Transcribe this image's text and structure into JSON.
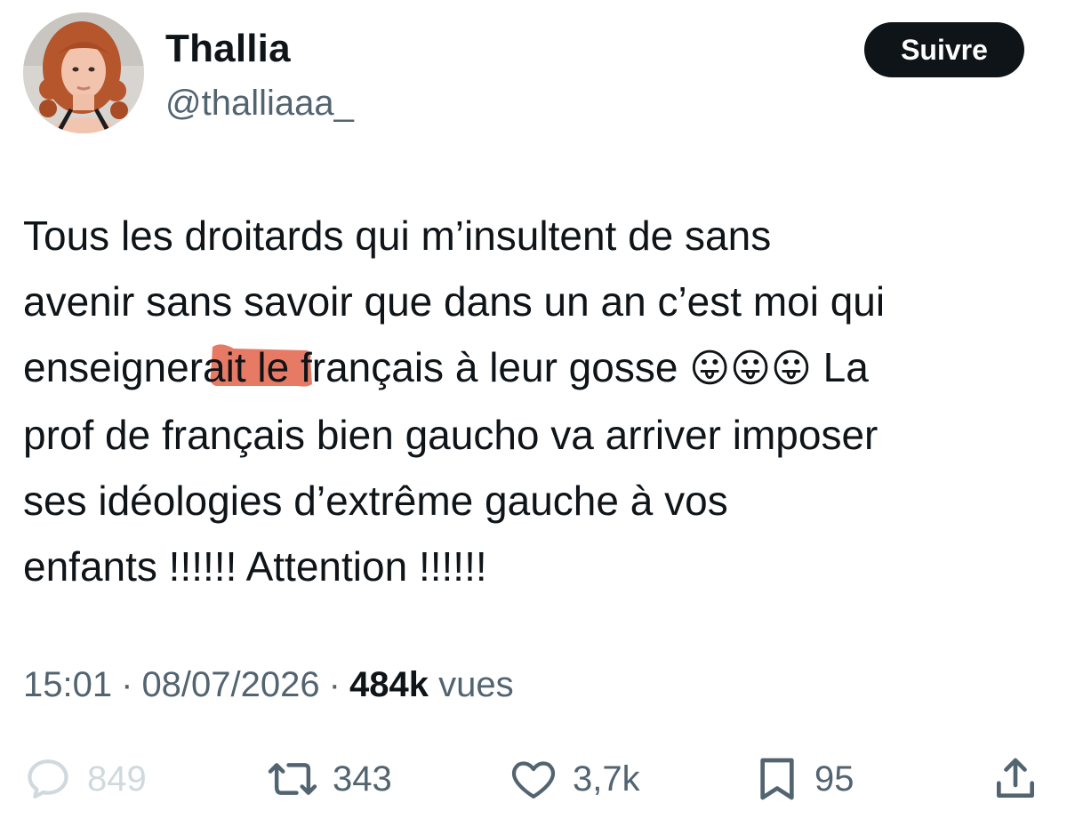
{
  "user": {
    "display_name": "Thallia",
    "handle": "@thalliaaa_",
    "follow_label": "Suivre"
  },
  "tweet": {
    "text_lines": [
      "Tous les droitards qui m’insultent de sans",
      "avenir sans savoir que dans un an c’est moi qui",
      "enseignerait le français à leur gosse ",
      "prof de français bien gaucho va arriver imposer",
      "ses idéologies d’extrême gauche à vos",
      "enfants !!!!!! Attention !!!!!!"
    ],
    "emojis": "😛😛😛",
    "line3_tail": " La",
    "highlight_color": "#e0553a"
  },
  "meta": {
    "time": "15:01",
    "date": "08/07/2026",
    "views_count": "484k",
    "views_label": "vues",
    "separator": "·"
  },
  "actions": {
    "reply": {
      "icon": "reply-icon",
      "count": "849"
    },
    "repost": {
      "icon": "repost-icon",
      "count": "343"
    },
    "like": {
      "icon": "heart-icon",
      "count": "3,7k"
    },
    "bookmark": {
      "icon": "bookmark-icon",
      "count": "95"
    },
    "share": {
      "icon": "share-icon"
    }
  },
  "colors": {
    "text_primary": "#0f1419",
    "text_secondary": "#536471",
    "button_bg": "#0f1419",
    "button_text": "#ffffff",
    "reply_faded": "#cfd9de"
  }
}
